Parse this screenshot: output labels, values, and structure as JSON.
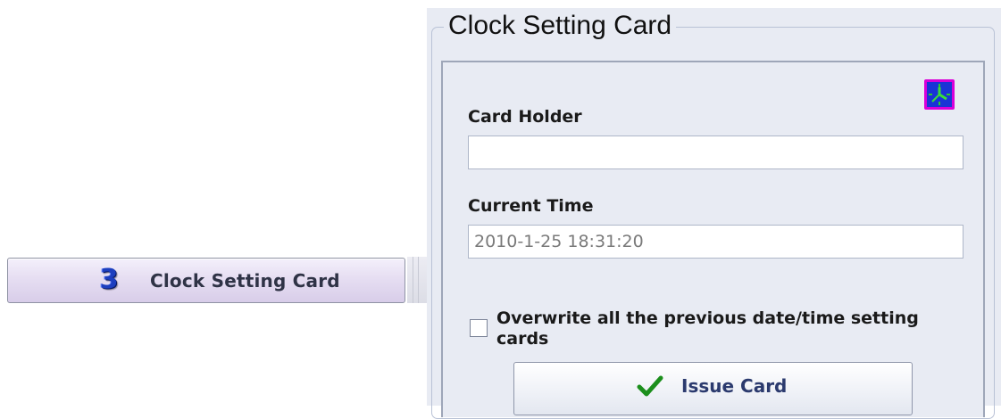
{
  "nav": {
    "step_number": "3",
    "label": "Clock Setting Card"
  },
  "panel": {
    "title": "Clock Setting Card",
    "card_holder": {
      "label": "Card Holder",
      "value": ""
    },
    "current_time": {
      "label": "Current Time",
      "value": "2010-1-25 18:31:20"
    },
    "overwrite": {
      "label": "Overwrite all the previous date/time setting cards",
      "checked": false
    },
    "issue_button": {
      "label": "Issue Card",
      "icon": "checkmark-icon"
    },
    "header_icon": "clock-icon"
  },
  "colors": {
    "nav_button": "#e0d7ee",
    "panel_bg": "#e8ebf3",
    "clock_icon_bg": "#1a34d6",
    "clock_icon_border": "#d900d9",
    "checkmark": "#1c8f1c"
  }
}
